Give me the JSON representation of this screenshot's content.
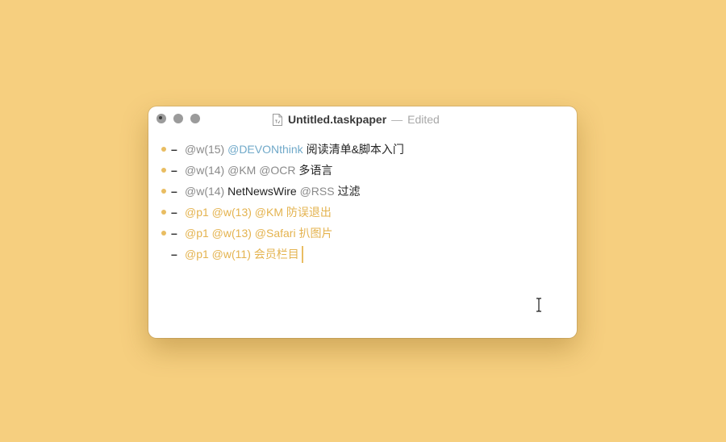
{
  "window": {
    "title": "Untitled.taskpaper",
    "separator": "—",
    "status": "Edited"
  },
  "items": [
    {
      "has_bullet": true,
      "segments": [
        {
          "text": "@w(15) ",
          "style": "tag"
        },
        {
          "text": "@DEVONthink",
          "style": "blue"
        },
        {
          "text": " 阅读清单&脚本入门",
          "style": "text"
        }
      ]
    },
    {
      "has_bullet": true,
      "segments": [
        {
          "text": "@w(14) @KM @OCR",
          "style": "tag"
        },
        {
          "text": " 多语言",
          "style": "text"
        }
      ]
    },
    {
      "has_bullet": true,
      "segments": [
        {
          "text": "@w(14) ",
          "style": "tag"
        },
        {
          "text": "NetNewsWire ",
          "style": "text"
        },
        {
          "text": "@RSS",
          "style": "tag"
        },
        {
          "text": " 过滤",
          "style": "text"
        }
      ]
    },
    {
      "has_bullet": true,
      "segments": [
        {
          "text": "@p1 @w(13) @KM 防误退出",
          "style": "gold"
        }
      ]
    },
    {
      "has_bullet": true,
      "segments": [
        {
          "text": "@p1 @w(13) @Safari 扒图片",
          "style": "gold"
        }
      ]
    },
    {
      "has_bullet": false,
      "caret": true,
      "segments": [
        {
          "text": "@p1 @w(11) 会员栏目",
          "style": "gold"
        }
      ]
    }
  ],
  "dash_glyph": "–",
  "colors": {
    "background": "#f6cf7f",
    "bullet": "#e9bd62",
    "tag_gray": "#8a8a8a",
    "tag_blue": "#70a9c9",
    "priority_gold": "#e4b34f"
  }
}
